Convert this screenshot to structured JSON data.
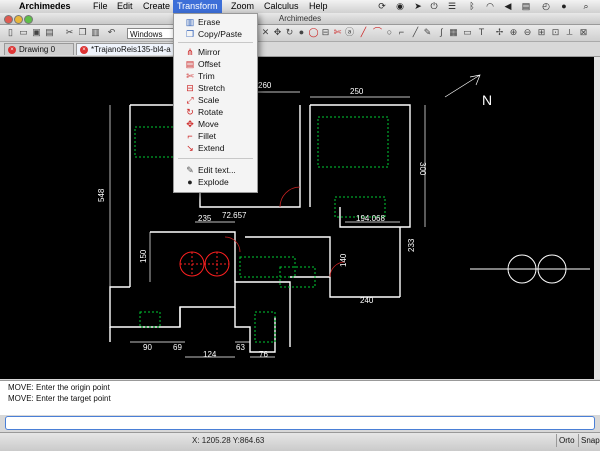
{
  "menubar": {
    "app": "Archimedes",
    "items": [
      "File",
      "Edit",
      "Create",
      "Transform",
      "Zoom",
      "Calculus",
      "Help"
    ]
  },
  "window": {
    "title": "Archimedes"
  },
  "toolbar": {
    "windows_select": "Windows"
  },
  "tabs": [
    {
      "label": "Drawing 0"
    },
    {
      "label": "*TrajanoReis135-bl4-a"
    }
  ],
  "transform_menu": {
    "items": [
      {
        "label": "Erase",
        "icon": "erase-icon"
      },
      {
        "label": "Copy/Paste",
        "icon": "copy-icon"
      },
      {
        "label": "Mirror",
        "icon": "mirror-icon"
      },
      {
        "label": "Offset",
        "icon": "offset-icon"
      },
      {
        "label": "Trim",
        "icon": "trim-icon"
      },
      {
        "label": "Stretch",
        "icon": "stretch-icon"
      },
      {
        "label": "Scale",
        "icon": "scale-icon"
      },
      {
        "label": "Rotate",
        "icon": "rotate-icon"
      },
      {
        "label": "Move",
        "icon": "move-icon"
      },
      {
        "label": "Fillet",
        "icon": "fillet-icon"
      },
      {
        "label": "Extend",
        "icon": "extend-icon"
      },
      {
        "label": "Edit text...",
        "icon": "text-icon"
      },
      {
        "label": "Explode",
        "icon": "explode-icon"
      }
    ]
  },
  "drawing": {
    "dimensions": [
      "260",
      "250",
      "300",
      "548",
      "235",
      "72.657",
      "194.068",
      "150",
      "140",
      "233",
      "240",
      "90",
      "69",
      "124",
      "63",
      "76"
    ],
    "north_label": "N",
    "colors": {
      "walls": "#ffffff",
      "furniture": "#00cc33",
      "fixtures": "#ff2020",
      "doors": "#cc2222"
    }
  },
  "command_log": [
    "MOVE: Enter the origin point",
    "MOVE: Enter the target point"
  ],
  "command_input": {
    "value": ""
  },
  "status": {
    "coords": "X: 1205.28 Y:864.63",
    "ortho": "Orto",
    "snap": "Snap"
  }
}
